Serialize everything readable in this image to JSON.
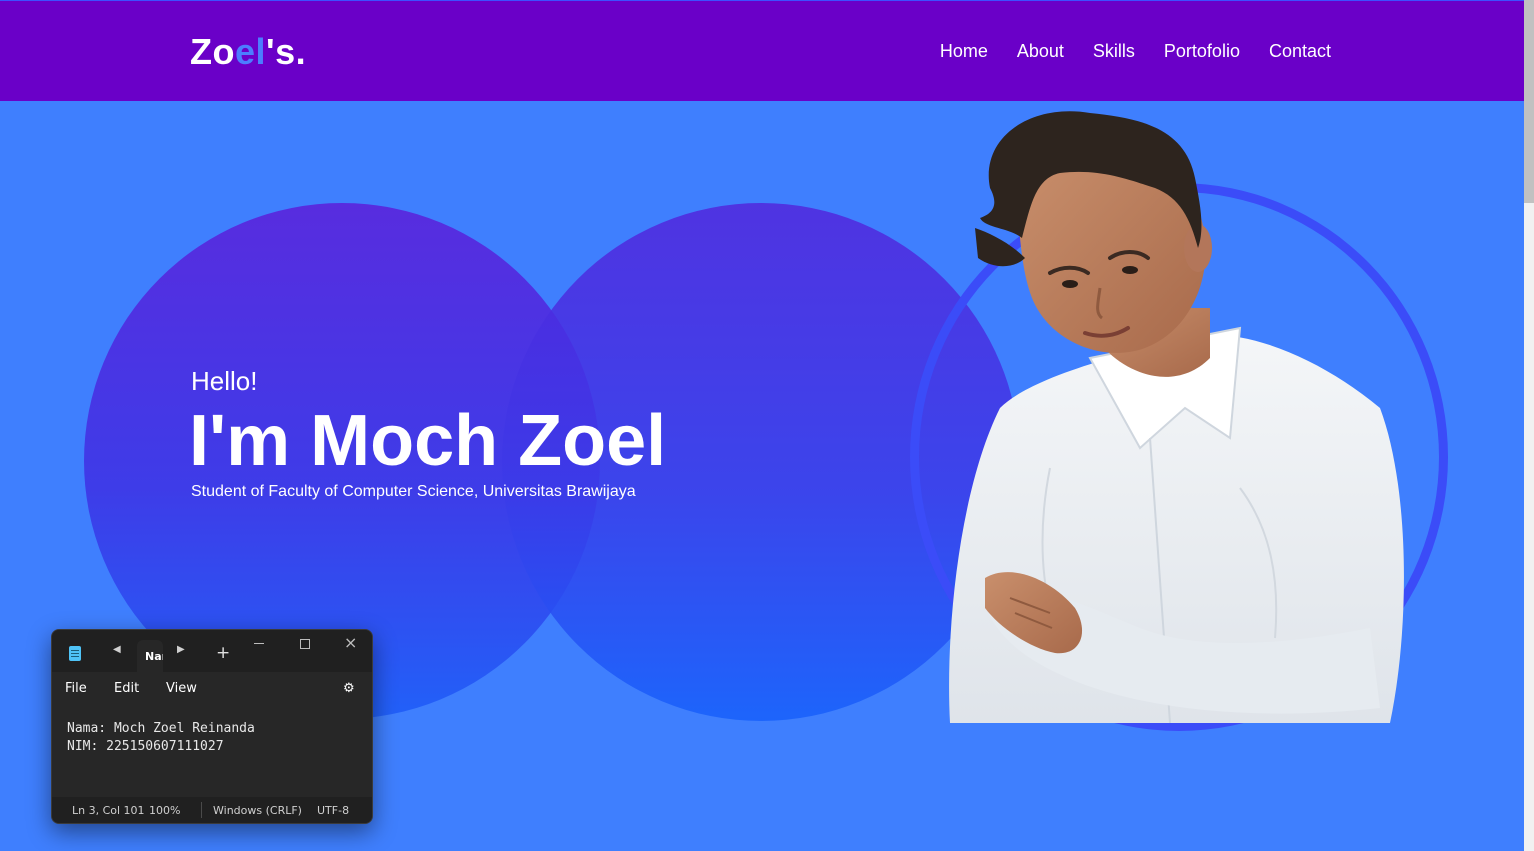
{
  "header": {
    "logo_part1": "Zo",
    "logo_accent": "el",
    "logo_part2": "'s.",
    "nav": [
      "Home",
      "About",
      "Skills",
      "Portofolio",
      "Contact"
    ]
  },
  "hero": {
    "greeting": "Hello!",
    "name": "I'm Moch Zoel",
    "subtitle": "Student of Faculty of Computer Science, Universitas Brawijaya"
  },
  "notepad": {
    "tab_label": "Nan",
    "menu": [
      "File",
      "Edit",
      "View"
    ],
    "line1": "Nama: Moch Zoel Reinanda",
    "line2": "NIM: 225150607111027",
    "status": {
      "position": "Ln 3, Col 101",
      "zoom": "100%",
      "line_ending": "Windows (CRLF)",
      "encoding": "UTF-8"
    }
  },
  "colors": {
    "navbar": "#6a00c8",
    "background": "#3f7ffe",
    "logo_accent": "#4c7dff",
    "ring": "#3b4cf8"
  }
}
